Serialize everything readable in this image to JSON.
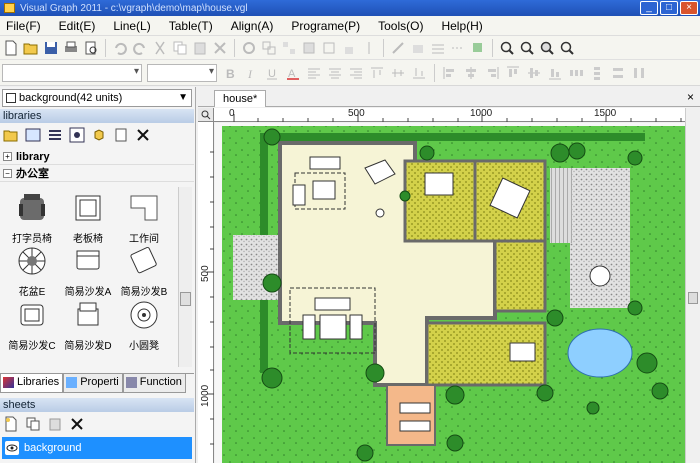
{
  "window": {
    "title": "Visual Graph 2011 - c:\\vgraph\\demo\\map\\house.vgl"
  },
  "menu": [
    "File(F)",
    "Edit(E)",
    "Line(L)",
    "Table(T)",
    "Align(A)",
    "Programe(P)",
    "Tools(O)",
    "Help(H)"
  ],
  "left_panel": {
    "background_select": "background(42 units)",
    "libraries_header": "libraries",
    "tree": {
      "library": "library",
      "category": "办公室"
    },
    "items": [
      "打字员椅",
      "老板椅",
      "工作间",
      "花盆E",
      "简易沙发A",
      "简易沙发B",
      "简易沙发C",
      "简易沙发D",
      "小圆凳"
    ],
    "tabs": [
      "Libraries",
      "Properti",
      "Function"
    ],
    "sheets_header": "sheets",
    "sheet_name": "background"
  },
  "document": {
    "tab": "house*",
    "ruler_h": [
      "0",
      "500",
      "1000",
      "1500"
    ],
    "ruler_v": [
      "500",
      "1000"
    ]
  },
  "colors": {
    "lawn": "#5fc94a",
    "floor": "#f6f4d6",
    "wall": "#6a6a6a",
    "room_hatch": "#c8c63a",
    "paving": "#cfcfcf",
    "pool": "#8ecfff",
    "tree": "#2d8c2a",
    "selection": "#1e90ff"
  }
}
